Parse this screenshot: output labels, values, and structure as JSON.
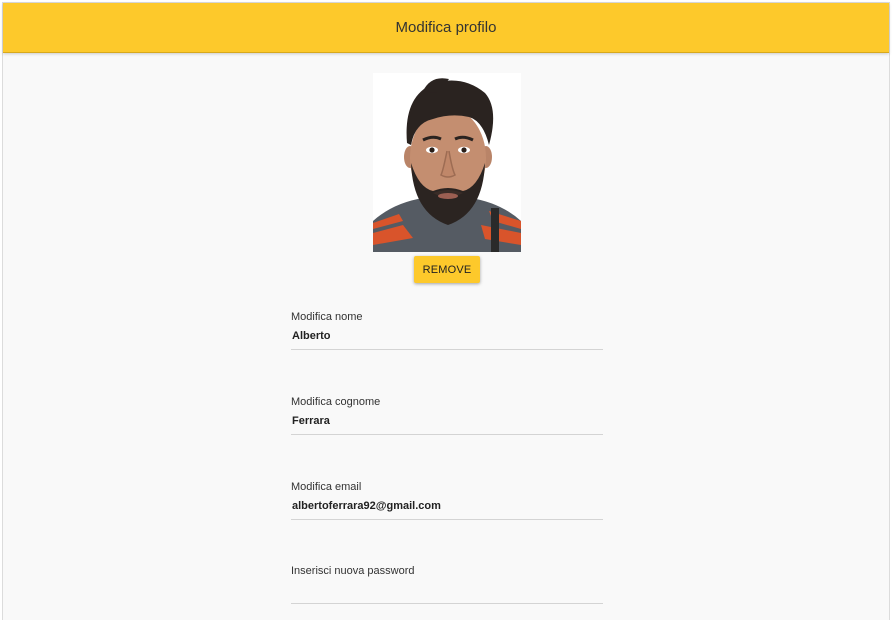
{
  "header": {
    "title": "Modifica profilo",
    "background_color": "#fdc92b"
  },
  "profile_photo": {
    "icon": "user-portrait"
  },
  "actions": {
    "remove_label": "REMOVE"
  },
  "form": {
    "first_name": {
      "label": "Modifica nome",
      "value": "Alberto"
    },
    "last_name": {
      "label": "Modifica cognome",
      "value": "Ferrara"
    },
    "email": {
      "label": "Modifica email",
      "value": "albertoferrara92@gmail.com"
    },
    "password": {
      "label": "Inserisci nuova password",
      "value": ""
    }
  }
}
